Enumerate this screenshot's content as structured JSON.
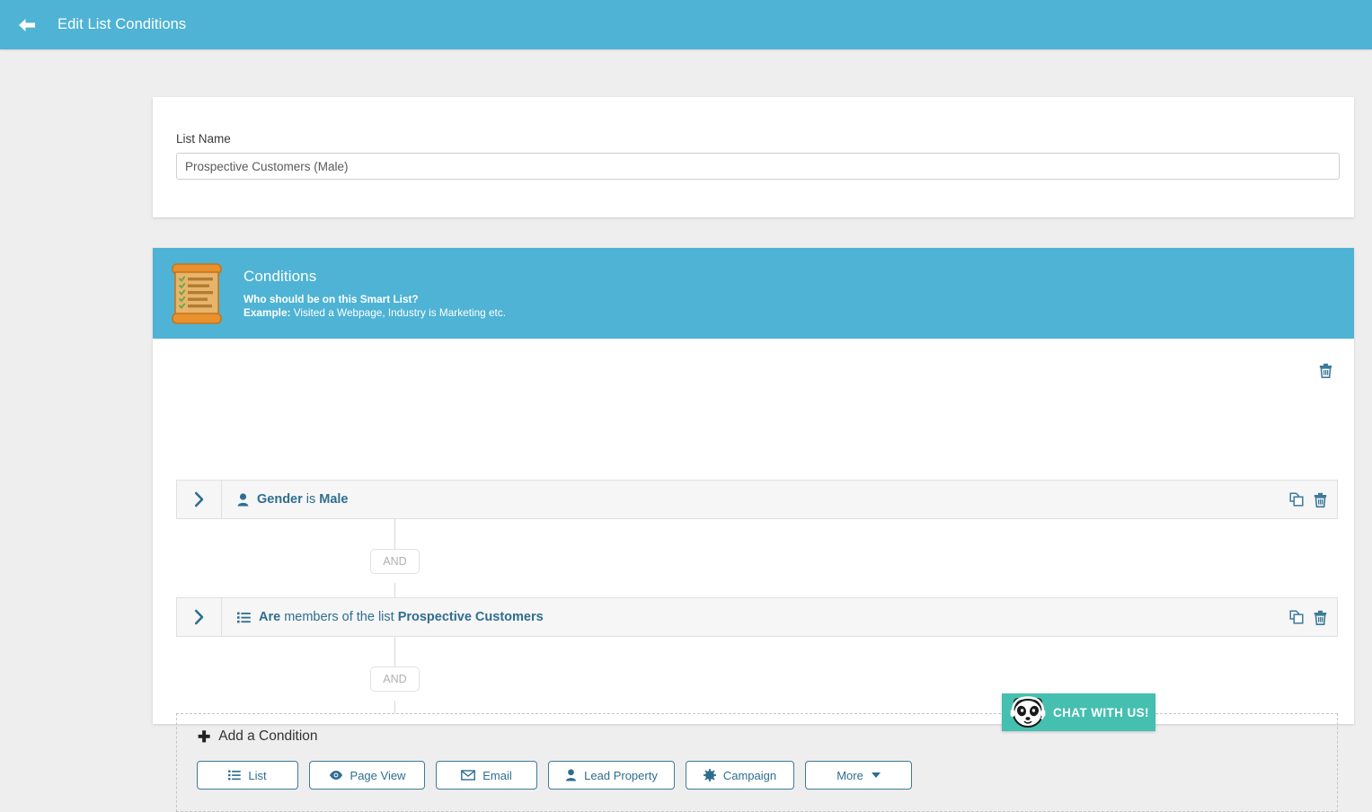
{
  "header": {
    "title": "Edit List Conditions",
    "back_icon": "arrow-left-icon",
    "bg_color": "#4eb3d4"
  },
  "list_name_card": {
    "label": "List Name",
    "value": "Prospective Customers (Male)",
    "placeholder": "List Name"
  },
  "conditions_panel": {
    "icon": "scroll-checklist-icon",
    "title": "Conditions",
    "subtitle_line1": "Who should be on this Smart List?",
    "example_label": "Example:",
    "example_text": " Visited a Webpage, Industry is Marketing etc.",
    "group_delete_icon": "trash-icon",
    "rules": [
      {
        "expander_icon": "chevron-right-icon",
        "type_icon": "person-icon",
        "subject": "Gender",
        "operator": "is",
        "value": "Male",
        "copy_icon": "copy-icon",
        "delete_icon": "trash-icon"
      },
      {
        "expander_icon": "chevron-right-icon",
        "type_icon": "list-icon",
        "subject": "Are",
        "operator": "members of the list",
        "value": "Prospective Customers",
        "copy_icon": "copy-icon",
        "delete_icon": "trash-icon"
      }
    ],
    "connectors": [
      "AND",
      "AND"
    ]
  },
  "add_condition": {
    "plus_icon": "plus-icon",
    "title": "Add a Condition",
    "buttons": [
      {
        "label": "List",
        "icon": "list-icon"
      },
      {
        "label": "Page View",
        "icon": "eye-icon"
      },
      {
        "label": "Email",
        "icon": "envelope-icon"
      },
      {
        "label": "Lead Property",
        "icon": "person-icon"
      },
      {
        "label": "Campaign",
        "icon": "gear-icon"
      },
      {
        "label": "More",
        "icon": "caret-down-icon"
      }
    ]
  },
  "chat_widget": {
    "label": "CHAT WITH US!",
    "icon": "panda-headset-icon",
    "bg_color": "#45bfb0"
  },
  "theme": {
    "accent": "#4eb3d4",
    "link_blue": "#2f6e8f",
    "icon_blue": "#3d7a99",
    "page_bg": "#efeeee"
  }
}
